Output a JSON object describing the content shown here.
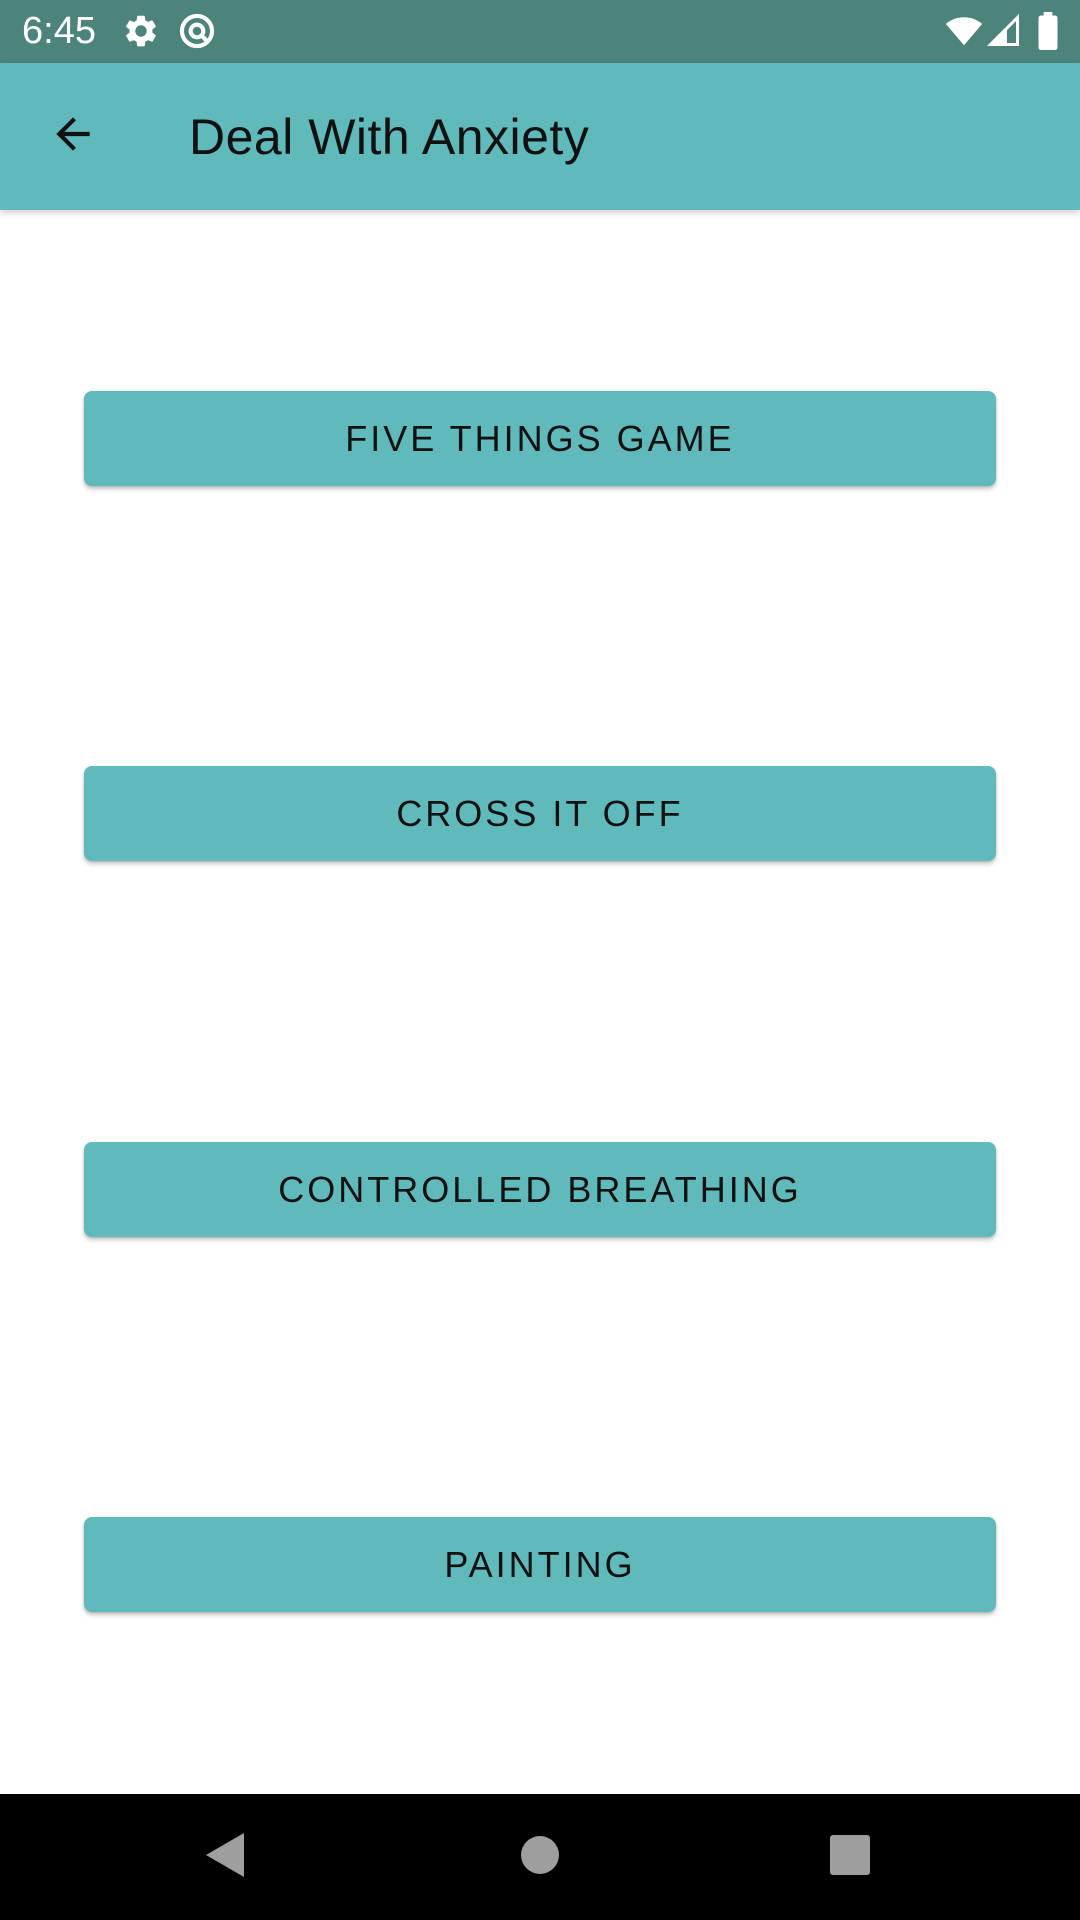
{
  "status_bar": {
    "time": "6:45",
    "icons_left": [
      "gear-icon",
      "at-sign-icon"
    ],
    "icons_right": [
      "wifi-icon",
      "cellular-signal-icon",
      "battery-icon"
    ],
    "background_color": "#4c847b"
  },
  "app_bar": {
    "title": "Deal With Anxiety",
    "back_icon": "arrow-back-icon",
    "background_color": "#60babc"
  },
  "buttons": [
    {
      "label": "FIVE THINGS GAME"
    },
    {
      "label": "CROSS IT OFF"
    },
    {
      "label": "CONTROLLED BREATHING"
    },
    {
      "label": "PAINTING"
    }
  ],
  "button_color": "#60babc",
  "nav_bar": {
    "icons": [
      "back-triangle-icon",
      "home-circle-icon",
      "recents-square-icon"
    ],
    "background_color": "#000000"
  }
}
